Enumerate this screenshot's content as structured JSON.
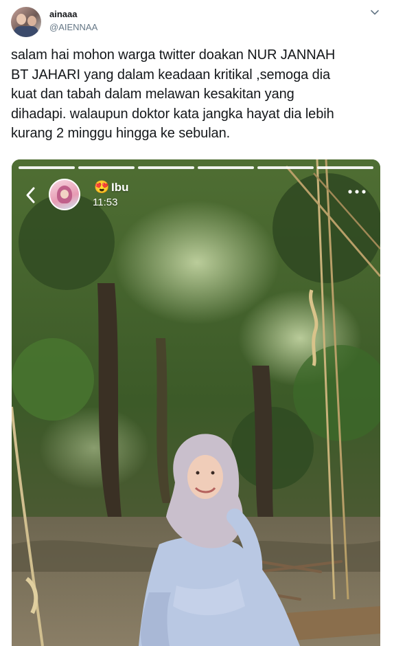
{
  "tweet": {
    "display_name": "ainaaa",
    "handle": "@AIENNAA",
    "text_lines": [
      "salam hai mohon warga twitter doakan NUR JANNAH",
      "BT JAHARI yang dalam keadaan kritikal ,semoga dia",
      "kuat dan tabah dalam melawan kesakitan yang",
      "dihadapi. walaupun doktor kata jangka hayat dia lebih",
      "kurang 2 minggu hingga ke sebulan."
    ],
    "icons": {
      "avatar": "profile-avatar",
      "menu": "chevron-down-icon"
    }
  },
  "story": {
    "progress_segments": 6,
    "emoji": "😍",
    "name": "Ibu",
    "time": "11:53",
    "icons": {
      "back": "back-chevron-icon",
      "more": "more-dots-icon"
    }
  },
  "colors": {
    "handle": "#657786",
    "text": "#14171a",
    "foliage_dark": "#2f4a22",
    "foliage_light": "#8bb35a",
    "dress": "#b9c8e3",
    "hijab": "#c9bfcc"
  }
}
